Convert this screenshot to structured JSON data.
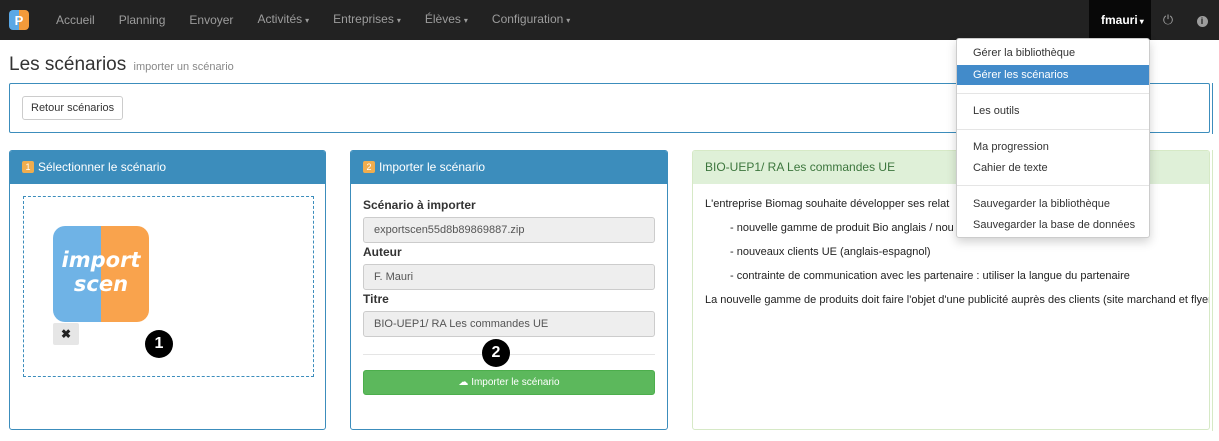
{
  "navbar": {
    "brand_letter": "P",
    "items": [
      {
        "label": "Accueil",
        "caret": false
      },
      {
        "label": "Planning",
        "caret": false
      },
      {
        "label": "Envoyer",
        "caret": false
      },
      {
        "label": "Activités",
        "caret": true
      },
      {
        "label": "Entreprises",
        "caret": true
      },
      {
        "label": "Élèves",
        "caret": true
      },
      {
        "label": "Configuration",
        "caret": true
      }
    ],
    "user": "fmauri",
    "power_icon": "power-icon",
    "info_icon": "info-icon"
  },
  "page": {
    "title": "Les scénarios",
    "subtitle": "importer un scénario",
    "back_button": "Retour scénarios"
  },
  "panel_select": {
    "step": "1",
    "title": "Sélectionner le scénario",
    "thumb_line1": "import",
    "thumb_line2": "scen",
    "remove_symbol": "✖"
  },
  "panel_import": {
    "step": "2",
    "title": "Importer le scénario",
    "fields": [
      {
        "label": "Scénario à importer",
        "value": "exportscen55d8b89869887.zip"
      },
      {
        "label": "Auteur",
        "value": "F. Mauri"
      },
      {
        "label": "Titre",
        "value": "BIO-UEP1/ RA Les commandes UE"
      }
    ],
    "submit_label": "Importer le scénario"
  },
  "panel_preview": {
    "title": "BIO-UEP1/ RA Les commandes UE",
    "intro": "L'entreprise Biomag souhaite développer ses relat",
    "bullets": [
      "- nouvelle gamme de produit Bio anglais / nou",
      "- nouveaux clients UE (anglais-espagnol)",
      "- contrainte de communication avec les partenaire : utiliser la langue du partenaire"
    ],
    "conclusion": "La nouvelle gamme de produits doit faire l'objet d'une publicité auprès des clients (site marchand et flyer)"
  },
  "user_menu": {
    "items": [
      {
        "label": "Gérer la bibliothèque",
        "active": false
      },
      {
        "label": "Gérer les scénarios",
        "active": true
      },
      {
        "label": "Les outils",
        "active": false
      },
      {
        "label": "Ma progression",
        "active": false
      },
      {
        "label": "Cahier de texte",
        "active": false
      },
      {
        "label": "Sauvegarder la bibliothèque",
        "active": false
      },
      {
        "label": "Sauvegarder la base de données",
        "active": false
      }
    ]
  },
  "markers": [
    "1",
    "2"
  ]
}
